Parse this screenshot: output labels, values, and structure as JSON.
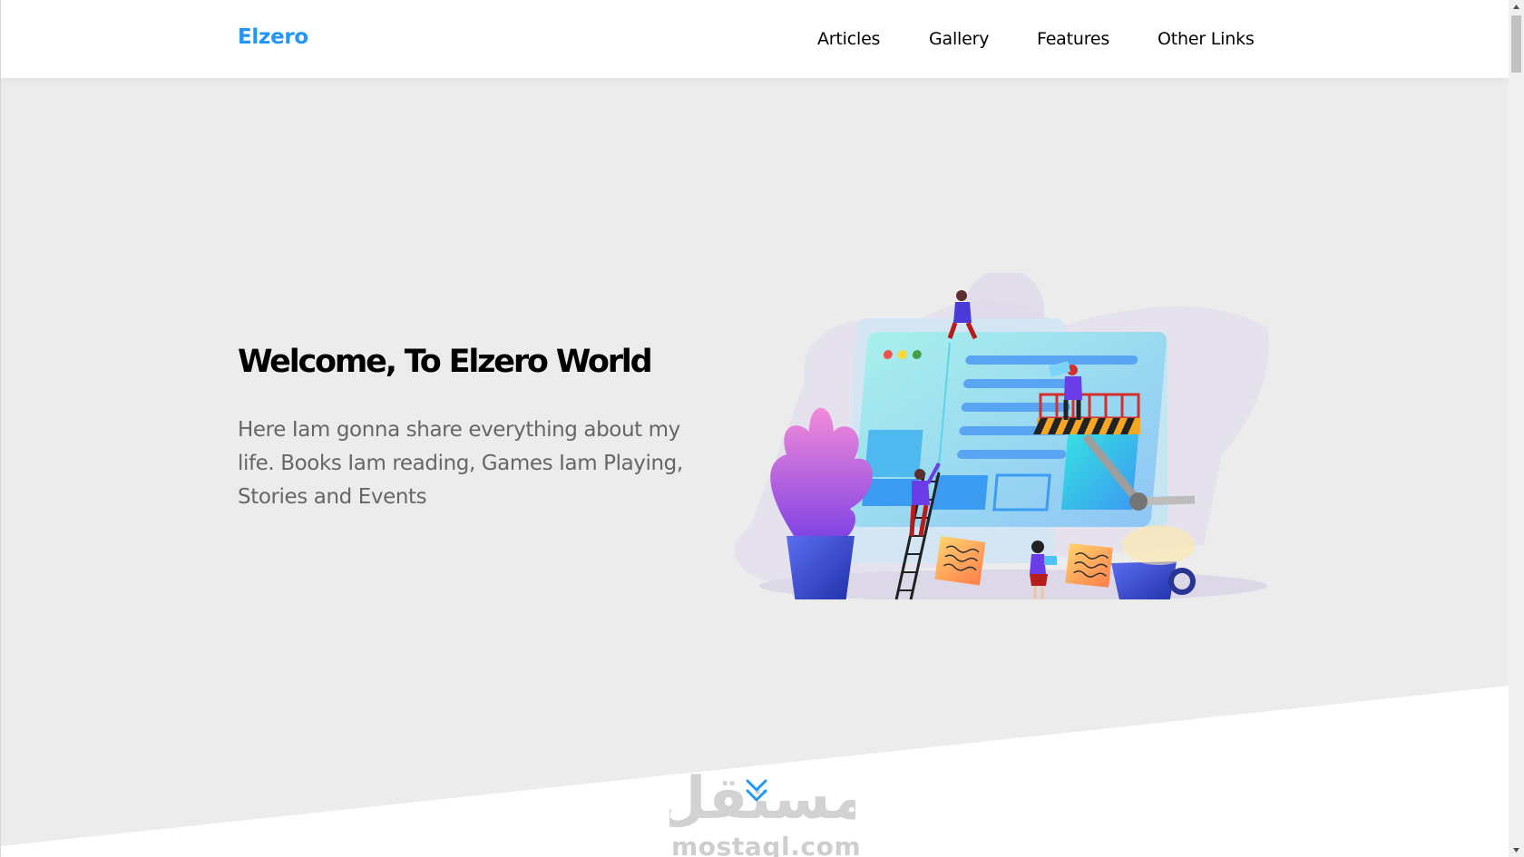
{
  "header": {
    "logo": "Elzero",
    "nav": [
      {
        "label": "Articles"
      },
      {
        "label": "Gallery"
      },
      {
        "label": "Features"
      },
      {
        "label": "Other Links"
      }
    ]
  },
  "landing": {
    "title": "Welcome, To Elzero World",
    "description": "Here Iam gonna share everything about my life. Books Iam reading, Games Iam Playing, Stories and Events",
    "illustration_icon": "team-building-website-illustration",
    "scroll_icon": "double-chevron-down-icon"
  },
  "watermark": {
    "arabic": "مستقل",
    "english": "mostaql.com"
  },
  "colors": {
    "accent": "#2196f3",
    "landing_bg": "#ececec",
    "text_muted": "#666666"
  }
}
